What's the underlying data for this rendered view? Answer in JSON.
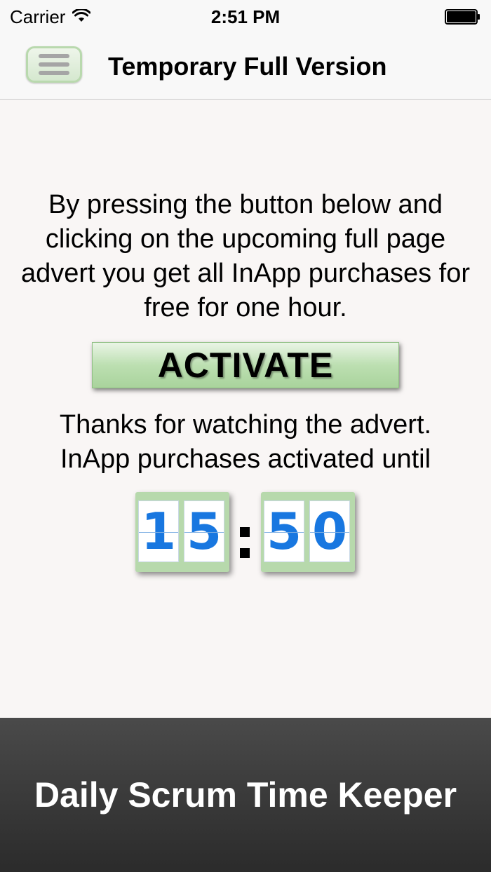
{
  "status_bar": {
    "carrier": "Carrier",
    "time": "2:51 PM",
    "wifi_icon": "wifi-icon",
    "battery_icon": "battery-icon"
  },
  "nav_bar": {
    "menu_icon": "hamburger-icon",
    "title": "Temporary Full Version"
  },
  "main": {
    "description": "By pressing the button below and clicking on the upcoming full page advert you get all InApp purchases for free for one hour.",
    "activate_label": "ACTIVATE",
    "thanks_line1": "Thanks for watching the advert.",
    "thanks_line2": "InApp purchases activated until",
    "clock": {
      "hour_digit_1": "1",
      "hour_digit_2": "5",
      "minute_digit_1": "5",
      "minute_digit_2": "0",
      "separator": ":"
    }
  },
  "footer": {
    "banner_text": "Daily Scrum Time Keeper"
  },
  "colors": {
    "accent_green": "#b7d9ac",
    "digit_blue": "#1877e0",
    "footer_dark": "#2b2b2b",
    "background": "#f9f6f5"
  }
}
